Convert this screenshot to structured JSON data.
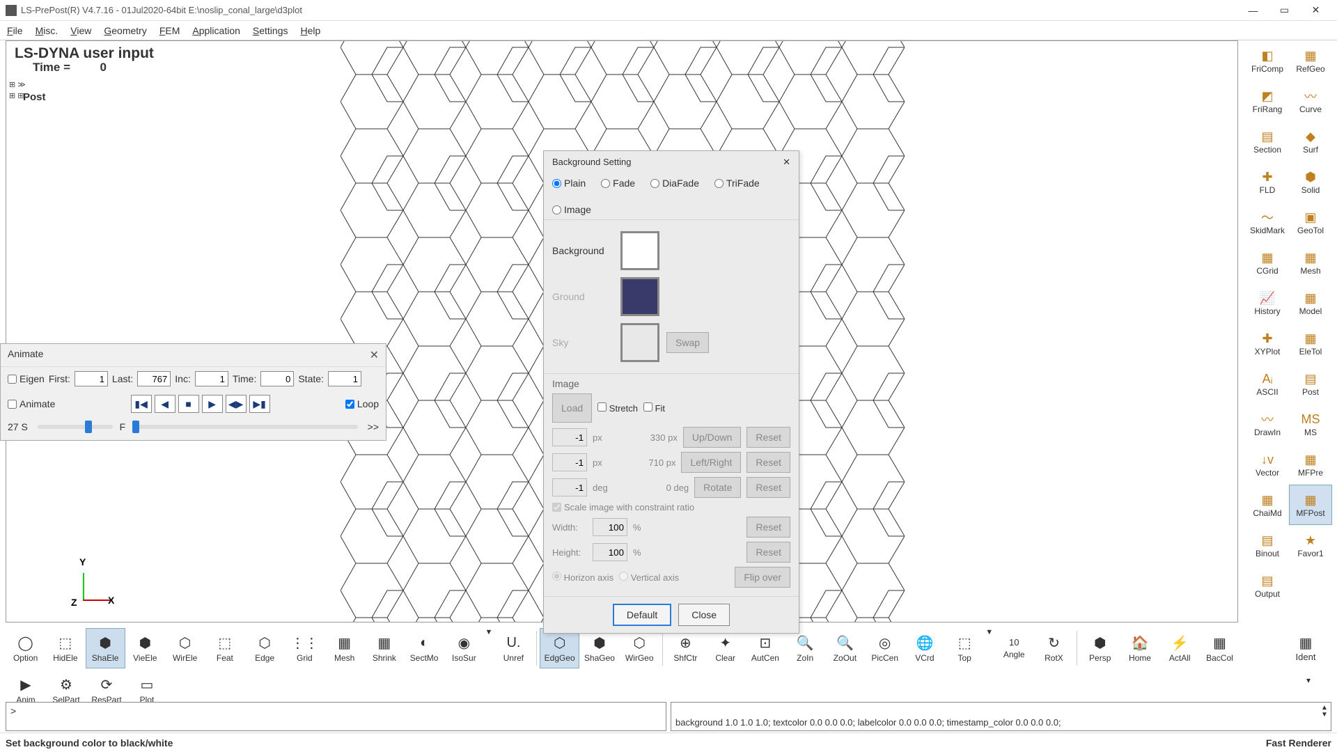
{
  "window": {
    "title": "LS-PrePost(R) V4.7.16 - 01Jul2020-64bit E:\\noslip_conal_large\\d3plot",
    "min": "—",
    "max": "▭",
    "close": "✕"
  },
  "menu": {
    "items": [
      "File",
      "Misc.",
      "View",
      "Geometry",
      "FEM",
      "Application",
      "Settings",
      "Help"
    ]
  },
  "viewport": {
    "header": "LS-DYNA user input",
    "time_label": "Time =",
    "time_value": "0",
    "tree": "Post",
    "axes": {
      "x": "X",
      "y": "Y",
      "z": "Z"
    }
  },
  "right_tools": [
    {
      "l": "FriComp",
      "i": "◧"
    },
    {
      "l": "RefGeo",
      "i": "▦"
    },
    {
      "l": "FriRang",
      "i": "◩"
    },
    {
      "l": "Curve",
      "i": "〰"
    },
    {
      "l": "Section",
      "i": "▤"
    },
    {
      "l": "Surf",
      "i": "◆"
    },
    {
      "l": "FLD",
      "i": "✚"
    },
    {
      "l": "Solid",
      "i": "⬢"
    },
    {
      "l": "SkidMark",
      "i": "〜"
    },
    {
      "l": "GeoTol",
      "i": "▣"
    },
    {
      "l": "CGrid",
      "i": "▦"
    },
    {
      "l": "Mesh",
      "i": "▦"
    },
    {
      "l": "History",
      "i": "📈"
    },
    {
      "l": "Model",
      "i": "▦"
    },
    {
      "l": "XYPlot",
      "i": "✚"
    },
    {
      "l": "EleTol",
      "i": "▦"
    },
    {
      "l": "ASCII",
      "i": "Aᵢ"
    },
    {
      "l": "Post",
      "i": "▤"
    },
    {
      "l": "DrawIn",
      "i": "〰"
    },
    {
      "l": "MS",
      "i": "MS"
    },
    {
      "l": "Vector",
      "i": "↓v"
    },
    {
      "l": "MFPre",
      "i": "▦"
    },
    {
      "l": "ChaiMd",
      "i": "▦"
    },
    {
      "l": "MFPost",
      "i": "▦",
      "sel": true
    },
    {
      "l": "Binout",
      "i": "▤"
    },
    {
      "l": "Favor1",
      "i": "★"
    },
    {
      "l": "Output",
      "i": "▤"
    }
  ],
  "bottom_row1": [
    {
      "l": "Option",
      "i": "◯"
    },
    {
      "l": "HidEle",
      "i": "⬚"
    },
    {
      "l": "ShaEle",
      "i": "⬢",
      "sel": true
    },
    {
      "l": "VieEle",
      "i": "⬢"
    },
    {
      "l": "WirEle",
      "i": "⬡"
    },
    {
      "l": "Feat",
      "i": "⬚"
    },
    {
      "l": "Edge",
      "i": "⬡"
    },
    {
      "l": "Grid",
      "i": "⋮⋮"
    },
    {
      "l": "Mesh",
      "i": "▦"
    },
    {
      "l": "Shrink",
      "i": "▦"
    },
    {
      "l": "SectMo",
      "i": "◐"
    },
    {
      "l": "IsoSur",
      "i": "◉"
    },
    {
      "drop": true
    },
    {
      "l": "Unref",
      "i": "U."
    },
    {
      "sep": true
    },
    {
      "l": "EdgGeo",
      "i": "⬡",
      "sel": true
    },
    {
      "l": "ShaGeo",
      "i": "⬢"
    },
    {
      "l": "WirGeo",
      "i": "⬡"
    },
    {
      "sep": true
    },
    {
      "l": "ShfCtr",
      "i": "⊕"
    },
    {
      "l": "Clear",
      "i": "✦"
    },
    {
      "l": "AutCen",
      "i": "⊡"
    },
    {
      "l": "ZoIn",
      "i": "🔍"
    },
    {
      "l": "ZoOut",
      "i": "🔍"
    },
    {
      "l": "PicCen",
      "i": "◎"
    },
    {
      "l": "VCrd",
      "i": "🌐"
    },
    {
      "l": "Top",
      "i": "⬚"
    },
    {
      "drop": true
    },
    {
      "l": "Angle",
      "i": "10",
      "angle": true
    },
    {
      "l": "RotX",
      "i": "↻"
    },
    {
      "sep": true
    },
    {
      "l": "Persp",
      "i": "⬢"
    },
    {
      "l": "Home",
      "i": "🏠"
    },
    {
      "l": "ActAll",
      "i": "⚡"
    },
    {
      "l": "BacCol",
      "i": "▦"
    }
  ],
  "bottom_row2": [
    {
      "l": "Anim",
      "i": "▶"
    },
    {
      "l": "SelPart",
      "i": "⚙"
    },
    {
      "l": "ResPart",
      "i": "⟳"
    },
    {
      "l": "Plot",
      "i": "▭"
    }
  ],
  "ident": {
    "l": "Ident",
    "i": "▦"
  },
  "animate": {
    "title": "Animate",
    "close": "✕",
    "eigen": "Eigen",
    "first_l": "First:",
    "first_v": "1",
    "last_l": "Last:",
    "last_v": "767",
    "inc_l": "Inc:",
    "inc_v": "1",
    "time_l": "Time:",
    "time_v": "0",
    "state_l": "State:",
    "state_v": "1",
    "animate_chk": "Animate",
    "loop": "Loop",
    "slider_left": "27 S",
    "slider_mid": "F",
    "slider_right": ">>"
  },
  "bg_dialog": {
    "title": "Background Setting",
    "close": "✕",
    "radios": [
      "Plain",
      "Fade",
      "DiaFade",
      "TriFade",
      "Image"
    ],
    "selected": "Plain",
    "bg_l": "Background",
    "ground_l": "Ground",
    "sky_l": "Sky",
    "swap": "Swap",
    "bg_color": "#ffffff",
    "ground_color": "#3a3a6a",
    "sky_color": "#e8e8e8",
    "img_title": "Image",
    "load": "Load",
    "stretch": "Stretch",
    "fit": "Fit",
    "r1_v": "-1",
    "r1_u": "px",
    "r1_d": "330 px",
    "r1_b": "Up/Down",
    "reset": "Reset",
    "r2_v": "-1",
    "r2_u": "px",
    "r2_d": "710 px",
    "r2_b": "Left/Right",
    "r3_v": "-1",
    "r3_u": "deg",
    "r3_d": "0 deg",
    "r3_b": "Rotate",
    "scale": "Scale image with constraint ratio",
    "width_l": "Width:",
    "width_v": "100",
    "height_l": "Height:",
    "height_v": "100",
    "pct": "%",
    "horiz": "Horizon axis",
    "vert": "Vertical axis",
    "flip": "Flip over",
    "default": "Default",
    "close_btn": "Close"
  },
  "cmd": {
    "left": ">",
    "right": "background 1.0 1.0 1.0; textcolor 0.0 0.0 0.0; labelcolor 0.0 0.0 0.0; timestamp_color 0.0 0.0 0.0;"
  },
  "status": {
    "msg": "Set background color to black/white",
    "renderer": "Fast Renderer"
  }
}
